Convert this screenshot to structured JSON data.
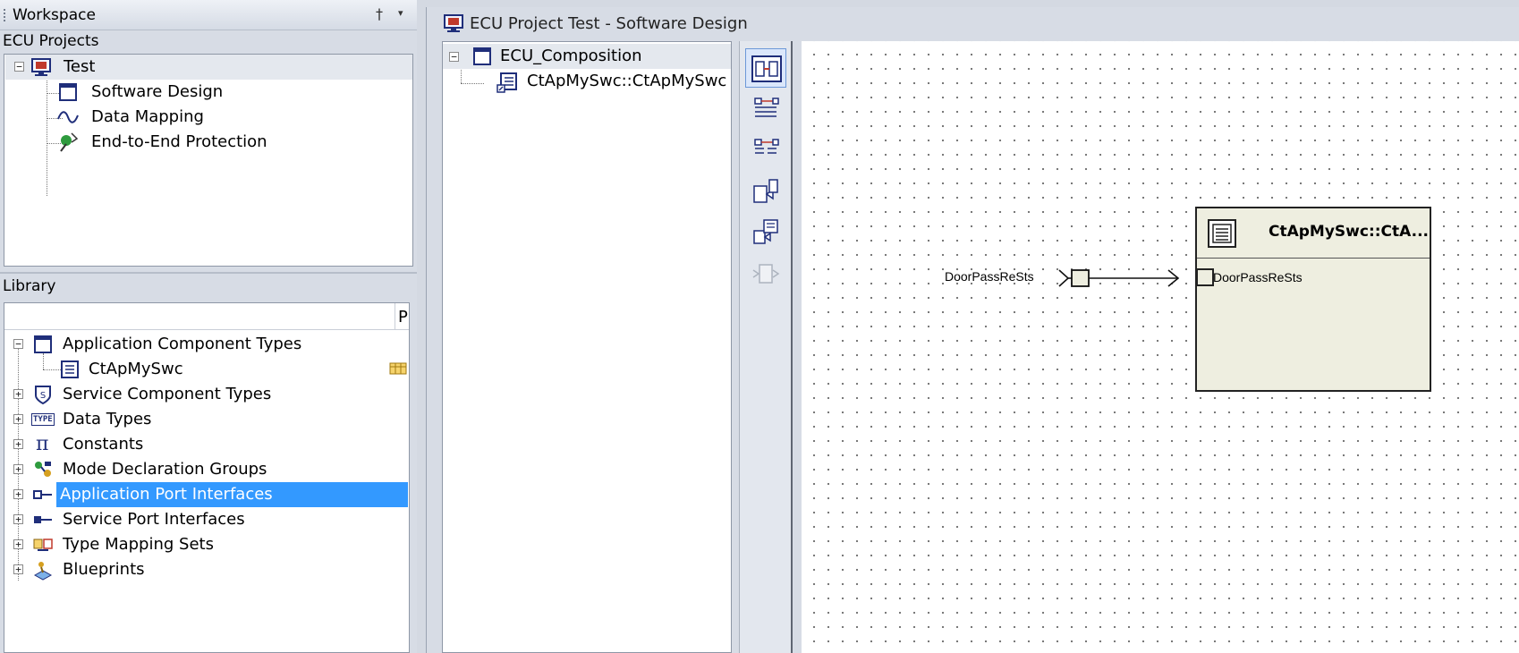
{
  "workspace": {
    "title": "Workspace",
    "pin_glyph": "†",
    "menu_glyph": "▾"
  },
  "ecu_projects": {
    "label": "ECU Projects",
    "items": [
      {
        "label": "Test",
        "icon": "ecu-project-icon"
      },
      {
        "label": "Software Design",
        "icon": "window-icon"
      },
      {
        "label": "Data Mapping",
        "icon": "wave-icon"
      },
      {
        "label": "End-to-End Protection",
        "icon": "protection-icon"
      }
    ]
  },
  "library": {
    "label": "Library",
    "column_header": "P",
    "items": [
      {
        "label": "Application Component Types",
        "expander": "−"
      },
      {
        "label": "CtApMySwc"
      },
      {
        "label": "Service Component Types",
        "expander": "+"
      },
      {
        "label": "Data Types",
        "expander": "+",
        "icon_text": "TYPE"
      },
      {
        "label": "Constants",
        "expander": "+",
        "icon_text": "π"
      },
      {
        "label": "Mode Declaration Groups",
        "expander": "+"
      },
      {
        "label": "Application Port Interfaces",
        "expander": "+",
        "selected": true
      },
      {
        "label": "Service Port Interfaces",
        "expander": "+"
      },
      {
        "label": "Type Mapping Sets",
        "expander": "+"
      },
      {
        "label": "Blueprints",
        "expander": "+"
      }
    ]
  },
  "document": {
    "title": "ECU Project Test - Software Design",
    "tree": [
      {
        "label": "ECU_Composition",
        "expander": "−"
      },
      {
        "label": "CtApMySwc::CtApMySwc"
      }
    ],
    "toolbar": [
      {
        "name": "composition-view-button",
        "active": true
      },
      {
        "name": "port-mapping-button"
      },
      {
        "name": "port-mapping-alt-button"
      },
      {
        "name": "component-ports-button"
      },
      {
        "name": "component-ports-alt-button"
      },
      {
        "name": "disabled-tool-button",
        "disabled": true
      }
    ]
  },
  "diagram": {
    "external_port_label": "DoorPassReSts",
    "component_title": "CtApMySwc::CtA...",
    "component_port_label": "DoorPassReSts"
  }
}
